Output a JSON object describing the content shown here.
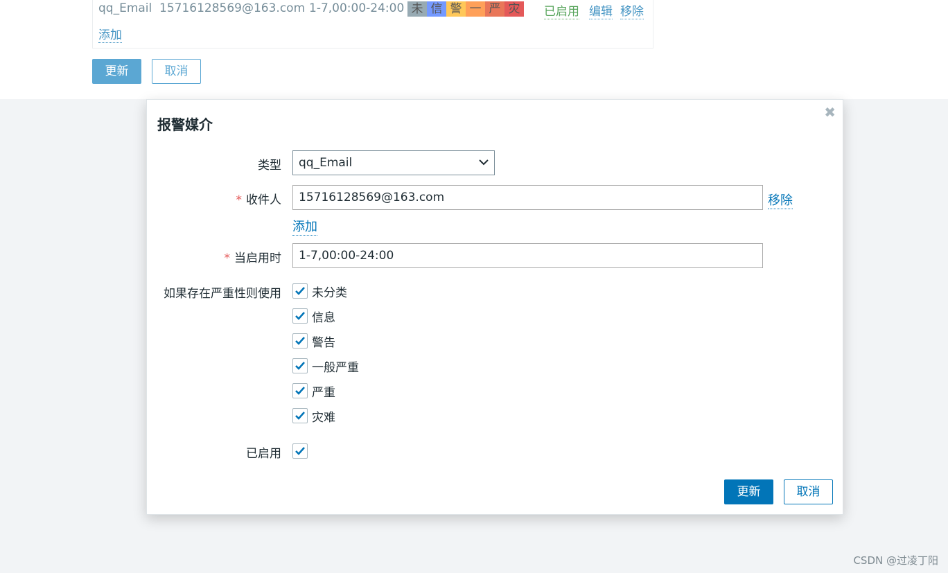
{
  "background": {
    "media_row": {
      "type": "qq_Email",
      "sendto": "15716128569@163.com",
      "when_active": "1-7,00:00-24:00",
      "severities": [
        {
          "label": "未",
          "color": "#97aab3"
        },
        {
          "label": "信",
          "color": "#7499ff"
        },
        {
          "label": "警",
          "color": "#ffc859"
        },
        {
          "label": "一",
          "color": "#ffa059"
        },
        {
          "label": "严",
          "color": "#e97659"
        },
        {
          "label": "灾",
          "color": "#e45959"
        }
      ],
      "status": "已启用",
      "edit_label": "编辑",
      "remove_label": "移除"
    },
    "add_label": "添加",
    "update_button": "更新",
    "cancel_button": "取消"
  },
  "dialog": {
    "title": "报警媒介",
    "type_label": "类型",
    "type_value": "qq_Email",
    "sendto_label": "收件人",
    "sendto_value": "15716128569@163.com",
    "remove_label": "移除",
    "add_label": "添加",
    "when_active_label": "当启用时",
    "when_active_value": "1-7,00:00-24:00",
    "severity_label": "如果存在严重性则使用",
    "severities": [
      {
        "label": "未分类",
        "checked": true
      },
      {
        "label": "信息",
        "checked": true
      },
      {
        "label": "警告",
        "checked": true
      },
      {
        "label": "一般严重",
        "checked": true
      },
      {
        "label": "严重",
        "checked": true
      },
      {
        "label": "灾难",
        "checked": true
      }
    ],
    "enabled_label": "已启用",
    "enabled_checked": true,
    "update_button": "更新",
    "cancel_button": "取消"
  },
  "colors": {
    "primary": "#0275b8",
    "required": "#e45959"
  },
  "watermark": "CSDN @过凌丁阳"
}
